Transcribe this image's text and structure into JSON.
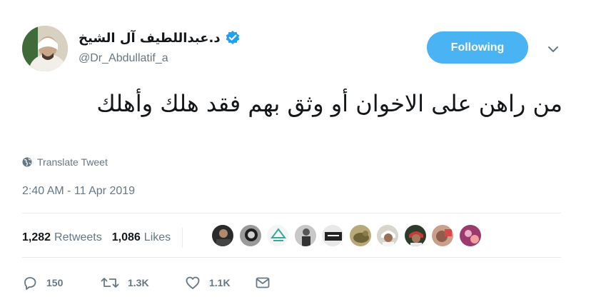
{
  "author": {
    "display_name": "د.عبداللطيف آل الشيخ",
    "handle": "@Dr_Abdullatif_a",
    "verified": true
  },
  "follow_button": {
    "label": "Following"
  },
  "tweet": {
    "text": "من راهن على الاخوان أو وثق بهم فقد هلك وأهلك",
    "translate_label": "Translate Tweet",
    "timestamp": "2:40 AM - 11 Apr 2019"
  },
  "stats": {
    "retweets_count": "1,282",
    "retweets_label": "Retweets",
    "likes_count": "1,086",
    "likes_label": "Likes"
  },
  "actions": {
    "reply_count": "150",
    "retweet_count": "1.3K",
    "like_count": "1.1K"
  },
  "colors": {
    "accent": "#4ab3f4",
    "verified": "#1da1f2",
    "secondary_text": "#657786",
    "divider": "#e6ecf0"
  },
  "icons": [
    "verified-badge-icon",
    "chevron-down-icon",
    "globe-icon",
    "reply-icon",
    "retweet-icon",
    "heart-icon",
    "mail-icon"
  ]
}
